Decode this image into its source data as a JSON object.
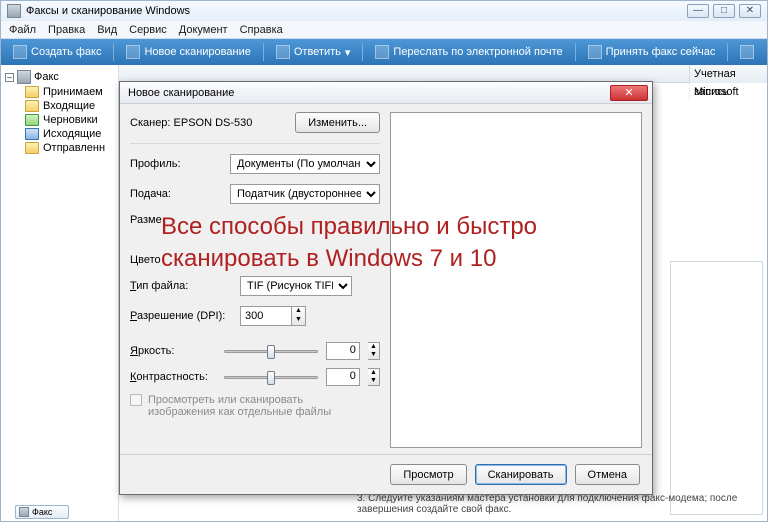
{
  "window": {
    "title": "Факсы и сканирование Windows",
    "controls": {
      "min": "—",
      "max": "□",
      "close": "✕"
    }
  },
  "menu": [
    "Файл",
    "Правка",
    "Вид",
    "Сервис",
    "Документ",
    "Справка"
  ],
  "toolbar": {
    "new_fax": "Создать факс",
    "new_scan": "Новое сканирование",
    "reply": "Ответить",
    "forward": "Переслать по электронной почте",
    "receive_now": "Принять факс сейчас"
  },
  "sidebar": {
    "root": "Факс",
    "items": [
      "Принимаем",
      "Входящие",
      "Черновики",
      "Исходящие",
      "Отправленн"
    ]
  },
  "list": {
    "account_header": "Учетная запись",
    "account_value": "Microsoft"
  },
  "dialog": {
    "title": "Новое сканирование",
    "scanner_label": "Сканер:",
    "scanner_value": "EPSON DS-530",
    "change_btn": "Изменить...",
    "profile_label": "Профиль:",
    "profile_value": "Документы (По умолчанию)",
    "feed_label": "Подача:",
    "feed_value": "Податчик (двустороннее сканир",
    "size_label": "Разме",
    "colorfmt_label": "Цвето",
    "filetype_label": "Тип файла:",
    "filetype_value": "TIF (Рисунок TIFF)",
    "dpi_label": "Разрешение (DPI):",
    "dpi_value": "300",
    "brightness_label": "Яркость:",
    "brightness_value": "0",
    "contrast_label": "Контрастность:",
    "contrast_value": "0",
    "separate_files": "Просмотреть или сканировать изображения как отдельные файлы",
    "preview_btn": "Просмотр",
    "scan_btn": "Сканировать",
    "cancel_btn": "Отмена"
  },
  "overlay": "Все способы правильно и быстро сканировать в Windows 7 и 10",
  "hint": "3.    Следуйте указаниям мастера установки для подключения факс-модема; после завершения создайте свой факс.",
  "thumb": "Факс"
}
